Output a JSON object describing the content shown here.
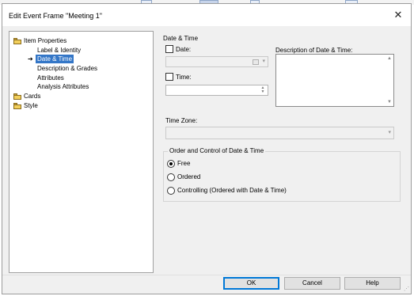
{
  "dialog": {
    "title": "Edit Event Frame \"Meeting 1\"",
    "close_label": "✕"
  },
  "tree": {
    "items": [
      {
        "label": "Item Properties",
        "icon": "folder-icon",
        "level": 0
      },
      {
        "label": "Label & Identity",
        "level": 1
      },
      {
        "label": "Date & Time",
        "level": 1,
        "selected": true,
        "marker": "arrow-icon"
      },
      {
        "label": "Description & Grades",
        "level": 1
      },
      {
        "label": "Attributes",
        "level": 1
      },
      {
        "label": "Analysis Attributes",
        "level": 1
      },
      {
        "label": "Cards",
        "icon": "folder-icon",
        "level": 0
      },
      {
        "label": "Style",
        "icon": "folder-icon",
        "level": 0
      }
    ],
    "arrow_glyph": "➔"
  },
  "panel": {
    "section_title": "Date & Time",
    "date_label": "Date:",
    "date_value": "",
    "time_label": "Time:",
    "time_value": "",
    "description_label": "Description of Date & Time:",
    "description_value": "",
    "timezone_label": "Time Zone:",
    "timezone_value": "",
    "order_group_title": "Order and Control of Date & Time",
    "order_options": [
      {
        "label": "Free",
        "checked": true
      },
      {
        "label": "Ordered",
        "checked": false
      },
      {
        "label": "Controlling (Ordered with Date & Time)",
        "checked": false
      }
    ]
  },
  "buttons": {
    "ok": "OK",
    "cancel": "Cancel",
    "help": "Help"
  }
}
